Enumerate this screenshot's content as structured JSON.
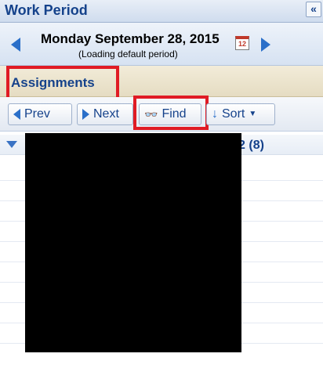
{
  "work_period": {
    "title": "Work Period",
    "collapse_label": "«",
    "date_label": "Monday September 28, 2015",
    "date_subtext": "(Loading default period)",
    "calendar_day": "12"
  },
  "assignments": {
    "title": "Assignments",
    "toolbar": {
      "prev_label": "Prev",
      "next_label": "Next",
      "find_label": "Find",
      "sort_label": "Sort"
    },
    "group_label": "Off Mgr 4082 (8)"
  },
  "colors": {
    "highlight": "#e01b24",
    "accent_blue": "#2a6fc9",
    "title_blue": "#15428b"
  }
}
